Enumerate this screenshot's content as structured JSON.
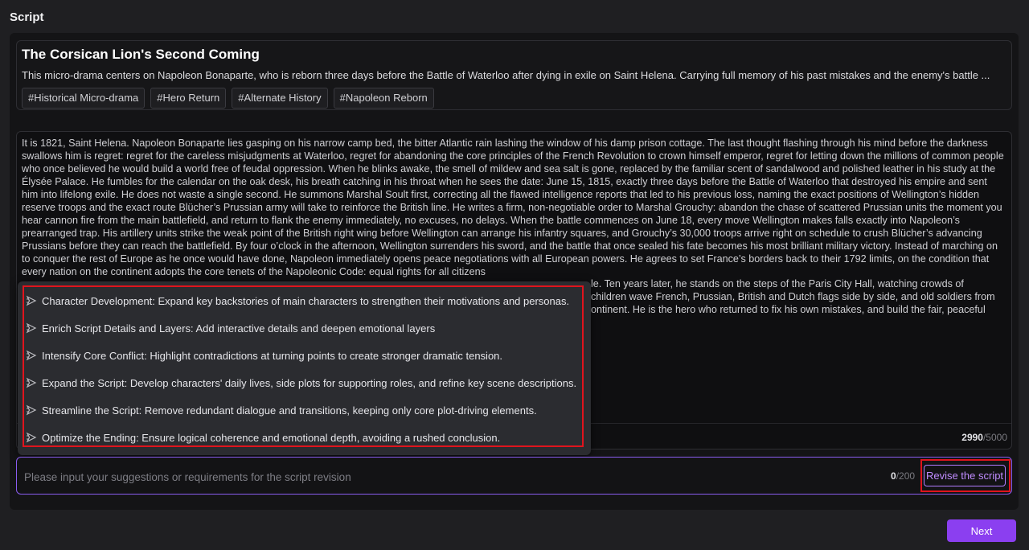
{
  "header": {
    "title": "Script"
  },
  "script": {
    "title": "The Corsican Lion's Second Coming",
    "summary": "This micro-drama centers on Napoleon Bonaparte, who is reborn three days before the Battle of Waterloo after dying in exile on Saint Helena. Carrying full memory of his past mistakes and the enemy's battle ...",
    "tags": [
      "#Historical Micro-drama",
      "#Hero Return",
      "#Alternate History",
      "#Napoleon Reborn"
    ]
  },
  "editor": {
    "text": "It is 1821, Saint Helena. Napoleon Bonaparte lies gasping on his narrow camp bed, the bitter Atlantic rain lashing the window of his damp prison cottage. The last thought flashing through his mind before the darkness swallows him is regret: regret for the careless misjudgments at Waterloo, regret for abandoning the core principles of the French Revolution to crown himself emperor, regret for letting down the millions of common people who once believed he would build a world free of feudal oppression. When he blinks awake, the smell of mildew and sea salt is gone, replaced by the familiar scent of sandalwood and polished leather in his study at the Élysée Palace. He fumbles for the calendar on the oak desk, his breath catching in his throat when he sees the date: June 15, 1815, exactly three days before the Battle of Waterloo that destroyed his empire and sent him into lifelong exile. He does not waste a single second. He summons Marshal Soult first, correcting all the flawed intelligence reports that led to his previous loss, naming the exact positions of Wellington’s hidden reserve troops and the exact route Blücher’s Prussian army will take to reinforce the British line. He writes a firm, non-negotiable order to Marshal Grouchy: abandon the chase of scattered Prussian units the moment you hear cannon fire from the main battlefield, and return to flank the enemy immediately, no excuses, no delays. When the battle commences on June 18, every move Wellington makes falls exactly into Napoleon’s prearranged trap. His artillery units strike the weak point of the British right wing before Wellington can arrange his infantry squares, and Grouchy’s 30,000 troops arrive right on schedule to crush Blücher’s advancing Prussians before they can reach the battlefield. By four o’clock in the afternoon, Wellington surrenders his sword, and the battle that once sealed his fate becomes his most brilliant military victory. Instead of marching on to conquer the rest of Europe as he once would have done, Napoleon immediately opens peace negotiations with all European powers. He agrees to set France’s borders back to their 1792 limits, on the condition that every nation on the continent adopts the core tenets of the Napoleonic Code: equal rights for all citizens",
    "tail_line_1": "le. Ten years later, he stands on the steps of the Paris City Hall, watching crowds of",
    "tail_line_2": "children wave French, Prussian, British and Dutch flags side by side, and old soldiers from",
    "tail_line_3": "ontinent. He is the hero who returned to fix his own mistakes, and build the fair, peaceful",
    "count": "2990",
    "max": "/5000"
  },
  "suggestions": [
    "Character Development: Expand key backstories of main characters to strengthen their motivations and personas.",
    "Enrich Script Details and Layers: Add interactive details and deepen emotional layers",
    "Intensify Core Conflict: Highlight contradictions at turning points to create stronger dramatic tension.",
    "Expand the Script: Develop characters' daily lives, side plots for supporting roles, and refine key scene descriptions.",
    "Streamline the Script: Remove redundant dialogue and transitions, keeping only core plot-driving elements.",
    "Optimize the Ending: Ensure logical coherence and emotional depth, avoiding a rushed conclusion."
  ],
  "revision": {
    "placeholder": "Please input your suggestions or requirements for the script revision",
    "count": "0",
    "max": "/200",
    "button_label": "Revise the script"
  },
  "footer": {
    "next_label": "Next"
  },
  "colors": {
    "accent": "#8b3ff0",
    "highlight": "#e0141d",
    "border_focus": "#8a5cf0"
  },
  "icons": {
    "suggestion": "sparkle-arrow-icon"
  }
}
